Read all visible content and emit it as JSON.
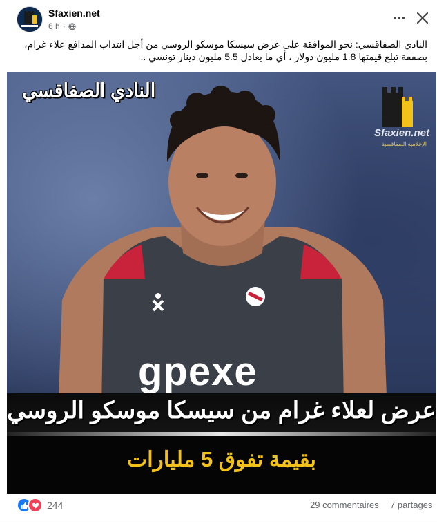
{
  "post": {
    "page_name": "Sfaxien.net",
    "time": "6 h",
    "separator": "·",
    "caption": "النادي الصفاقسي: نحو الموافقة على عرض سيسكا موسكو الروسي من أجل انتداب المدافع علاء غرام، بصفقة تبلغ قيمتها 1.8 مليون دولار ، أي ما يعادل 5.5 مليون دينار تونسي .."
  },
  "image": {
    "club_title": "النادي الصفاقسي",
    "logo_text": "Sfaxien.net",
    "logo_subtitle": "الإعلامية الصفاقسية",
    "shirt_text": "gpexe",
    "headline": "عرض لعلاء غرام من سيسكا موسكو الروسي",
    "subline": "بقيمة تفوق 5 مليارات"
  },
  "footer": {
    "reaction_count": "244",
    "comments": "29 commentaires",
    "shares": "7 partages"
  },
  "icons": {
    "more": "more-icon",
    "close": "close-icon",
    "globe": "globe-icon",
    "like": "like-icon",
    "love": "love-icon"
  },
  "colors": {
    "headline_text": "#ffffff",
    "subline_text": "#f2c21b",
    "like": "#1877f2",
    "love": "#f33e58"
  }
}
